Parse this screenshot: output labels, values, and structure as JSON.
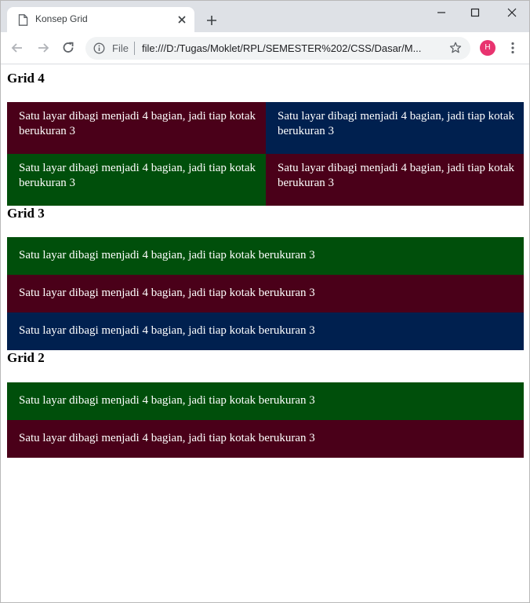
{
  "browser": {
    "tab_title": "Konsep Grid",
    "scheme_label": "File",
    "url": "file:///D:/Tugas/Moklet/RPL/SEMESTER%202/CSS/Dasar/M...",
    "avatar_letter": "H"
  },
  "colors": {
    "maroon": "#4a0019",
    "navy": "#00204f",
    "green": "#004f0b"
  },
  "sections": [
    {
      "heading": "Grid 4",
      "cells": [
        {
          "text": "Satu layar dibagi menjadi 4 bagian, jadi tiap kotak berukuran 3",
          "color": "maroon"
        },
        {
          "text": "Satu layar dibagi menjadi 4 bagian, jadi tiap kotak berukuran 3",
          "color": "navy"
        },
        {
          "text": "Satu layar dibagi menjadi 4 bagian, jadi tiap kotak berukuran 3",
          "color": "green"
        },
        {
          "text": "Satu layar dibagi menjadi 4 bagian, jadi tiap kotak berukuran 3",
          "color": "maroon"
        }
      ]
    },
    {
      "heading": "Grid 3",
      "cells": [
        {
          "text": "Satu layar dibagi menjadi 4 bagian, jadi tiap kotak berukuran 3",
          "color": "green"
        },
        {
          "text": "Satu layar dibagi menjadi 4 bagian, jadi tiap kotak berukuran 3",
          "color": "maroon"
        },
        {
          "text": "Satu layar dibagi menjadi 4 bagian, jadi tiap kotak berukuran 3",
          "color": "navy"
        }
      ]
    },
    {
      "heading": "Grid 2",
      "cells": [
        {
          "text": "Satu layar dibagi menjadi 4 bagian, jadi tiap kotak berukuran 3",
          "color": "green"
        },
        {
          "text": "Satu layar dibagi menjadi 4 bagian, jadi tiap kotak berukuran 3",
          "color": "maroon"
        }
      ]
    }
  ]
}
